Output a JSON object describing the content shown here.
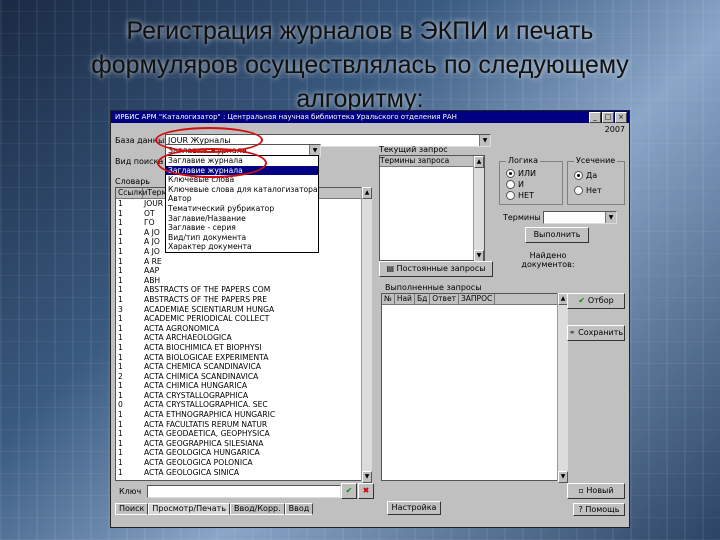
{
  "slide": {
    "title_lines": [
      "Регистрация журналов в ЭКПИ и печать",
      "формуляров осуществлялась по следующему",
      "алгоритму:"
    ]
  },
  "window": {
    "title": "ИРБИС  АРМ \"Каталогизатор\" : Центральная научная библиотека Уральского отделения РАН",
    "year": "2007",
    "db_label": "База данных",
    "db_value": "JOUR  Журналы",
    "search_label": "Вид поиска",
    "search_value": "Заглавие журнала",
    "dict_label": "Словарь",
    "dict_headers": [
      "Ссылки",
      "Термин"
    ],
    "dropdown_items": [
      "Заглавие журнала",
      "Заглавие журнала",
      "Ключевые слова",
      "Ключевые слова для каталогизатора",
      "Автор",
      "Тематический рубрикатор",
      "Заглавие/Название",
      "Заглавие - серия",
      "Вид/тип документа",
      "Характер документа"
    ],
    "dict_rows": [
      {
        "c1": "1",
        "c2": "JOUR 1"
      },
      {
        "c1": "1",
        "c2": "ОТ"
      },
      {
        "c1": "1",
        "c2": "ГО"
      },
      {
        "c1": "1",
        "c2": "A JO"
      },
      {
        "c1": "1",
        "c2": "A JO"
      },
      {
        "c1": "1",
        "c2": "A JO"
      },
      {
        "c1": "1",
        "c2": "A RE"
      },
      {
        "c1": "1",
        "c2": "AAP"
      },
      {
        "c1": "1",
        "c2": "ABH"
      },
      {
        "c1": "1",
        "c2": "ABSTRACTS OF THE PAPERS COM"
      },
      {
        "c1": "1",
        "c2": "ABSTRACTS OF THE PAPERS PRE"
      },
      {
        "c1": "3",
        "c2": "ACADEMIAE SCIENTIARUM HUNGA"
      },
      {
        "c1": "1",
        "c2": "ACADEMIC PERIODICAL COLLECT"
      },
      {
        "c1": "1",
        "c2": "ACTA AGRONOMICA"
      },
      {
        "c1": "1",
        "c2": "ACTA ARCHAEOLOGICA"
      },
      {
        "c1": "1",
        "c2": "ACTA BIOCHIMICA ET BIOPHYSI"
      },
      {
        "c1": "1",
        "c2": "ACTA BIOLOGICAE EXPERIMENTA"
      },
      {
        "c1": "1",
        "c2": "ACTA CHEMICA SCANDINAVICA"
      },
      {
        "c1": "2",
        "c2": "ACTA CHIMICA SCANDINAVICA"
      },
      {
        "c1": "1",
        "c2": "ACTA CHIMICA HUNGARICA"
      },
      {
        "c1": "1",
        "c2": "ACTA CRYSTALLOGRAPHICA"
      },
      {
        "c1": "0",
        "c2": "ACTA CRYSTALLOGRAPHICA. SEC"
      },
      {
        "c1": "1",
        "c2": "ACTA ETHNOGRAPHICA HUNGARIC"
      },
      {
        "c1": "1",
        "c2": "ACTA FACULTATIS RERUM NATUR"
      },
      {
        "c1": "1",
        "c2": "ACTA GEODAETICA, GEOPHYSICA"
      },
      {
        "c1": "1",
        "c2": "ACTA GEOGRAPHICA SILESIANA"
      },
      {
        "c1": "1",
        "c2": "ACTA GEOLOGICA HUNGARICA"
      },
      {
        "c1": "1",
        "c2": "ACTA GEOLOGICA POLONICA"
      },
      {
        "c1": "1",
        "c2": "ACTA GEOLOGICA SINICA"
      }
    ],
    "key_label": "Ключ",
    "current_query_label": "Текущий запрос",
    "current_query_header": "Термины запроса",
    "permanent_queries_btn": "Постоянные запросы",
    "logic_label": "Логика",
    "logic_options": [
      "ИЛИ",
      "И",
      "НЕТ"
    ],
    "truncation_label": "Усечение",
    "truncation_options": [
      "Да",
      "Нет"
    ],
    "term_label": "Термины",
    "run_btn": "Выполнить",
    "found_label": "Найдено документов:",
    "executed_label": "Выполненные запросы",
    "executed_headers": [
      "№",
      "Най",
      "Бд",
      "Ответ",
      "ЗАПРОС"
    ],
    "select_btn": "Отбор",
    "save_btn": "Сохранить",
    "settings_btn": "Настройка",
    "new_btn": "Новый",
    "help_btn": "Помощь",
    "tabs": [
      "Поиск",
      "Просмотр/Печать",
      "Ввод/Корр.",
      "Ввод"
    ]
  }
}
